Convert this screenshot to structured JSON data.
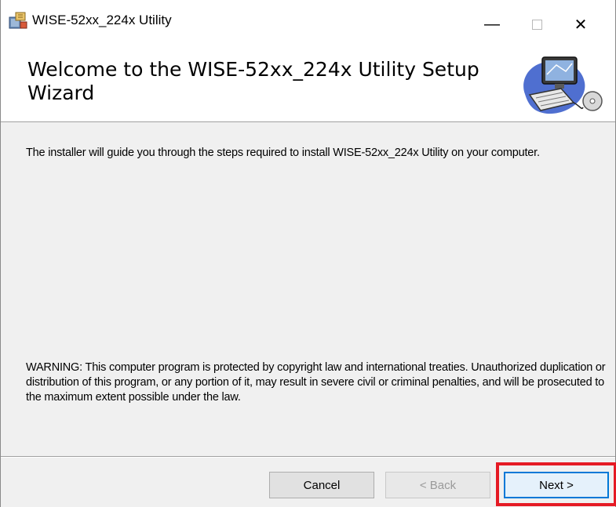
{
  "window": {
    "title": "WISE-52xx_224x Utility"
  },
  "caption_buttons": {
    "minimize": "—",
    "close": "✕"
  },
  "banner": {
    "title": "Welcome to the WISE-52xx_224x Utility Setup Wizard"
  },
  "body": {
    "intro": "The installer will guide you through the steps required to install WISE-52xx_224x Utility on your computer.",
    "warning": "WARNING: This computer program is protected by copyright law and international treaties. Unauthorized duplication or distribution of this program, or any portion of it, may result in severe civil or criminal penalties, and will be prosecuted to the maximum extent possible under the law."
  },
  "buttons": {
    "cancel": "Cancel",
    "back": "< Back",
    "next": "Next >"
  },
  "colors": {
    "highlight": "#e51a24",
    "focus": "#0078d7"
  }
}
